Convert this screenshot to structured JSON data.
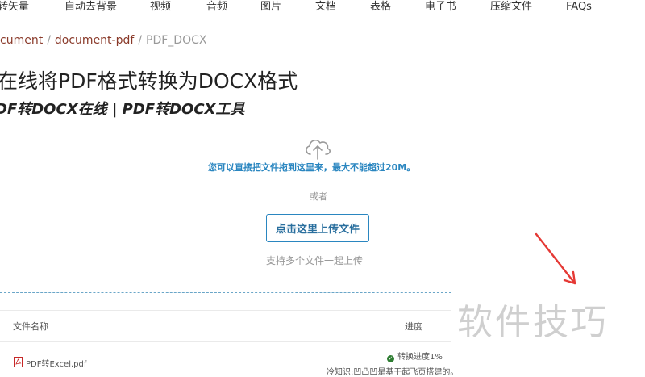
{
  "nav": {
    "items": [
      {
        "label": "转矢量"
      },
      {
        "label": "自动去背景"
      },
      {
        "label": "视频"
      },
      {
        "label": "音频"
      },
      {
        "label": "图片"
      },
      {
        "label": "文档"
      },
      {
        "label": "表格"
      },
      {
        "label": "电子书"
      },
      {
        "label": "压缩文件"
      },
      {
        "label": "FAQs"
      }
    ]
  },
  "breadcrumb": {
    "items": [
      "cument",
      "document-pdf"
    ],
    "current": "PDF_DOCX",
    "separator": "/"
  },
  "page": {
    "title": "在线将PDF格式转换为DOCX格式",
    "subtitle": "DF转DOCX在线 | PDF转DOCX工具"
  },
  "upload": {
    "icon": "cloud-upload-icon",
    "drop_text": "您可以直接把文件拖到这里来，最大不能超过20M。",
    "or_text": "或者",
    "button_label": "点击这里上传文件",
    "multi_text": "支持多个文件一起上传",
    "accent_color": "#2a86c0"
  },
  "table": {
    "columns": [
      "文件名称",
      "进度"
    ],
    "rows": [
      {
        "file_name": "PDF转Excel.pdf",
        "status": "转换进度1%",
        "note": "冷知识:凹凸凹是基于起飞页搭建的。"
      }
    ]
  },
  "watermark": {
    "text": "软件技巧"
  },
  "colors": {
    "breadcrumb_link": "#8a3a2a",
    "arrow": "#e53935",
    "status_ok": "#2e7d32"
  }
}
